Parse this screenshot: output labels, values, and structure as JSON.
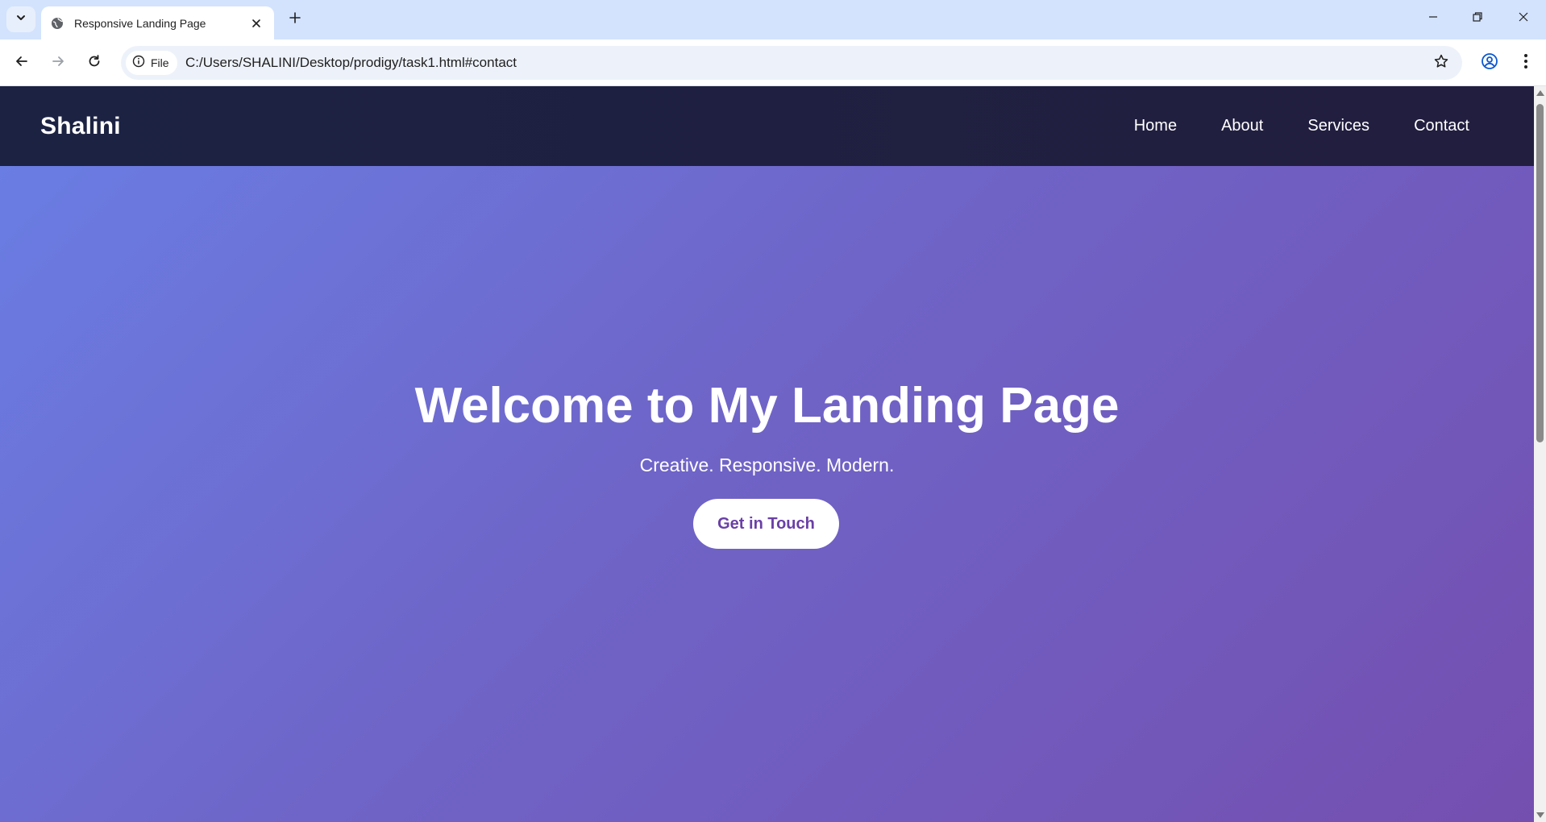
{
  "browser": {
    "tab": {
      "title": "Responsive Landing Page",
      "favicon": "globe-icon"
    },
    "omnibox": {
      "chip_label": "File",
      "url": "C:/Users/SHALINI/Desktop/prodigy/task1.html#contact"
    }
  },
  "site": {
    "brand": "Shalini",
    "nav": [
      "Home",
      "About",
      "Services",
      "Contact"
    ]
  },
  "hero": {
    "title": "Welcome to My Landing Page",
    "subtitle": "Creative. Responsive. Modern.",
    "cta_label": "Get in Touch"
  },
  "colors": {
    "navbar": "#1c2242",
    "hero_gradient_start": "#6a7de3",
    "hero_gradient_end": "#744fb0",
    "cta_text": "#6a3fa6"
  }
}
